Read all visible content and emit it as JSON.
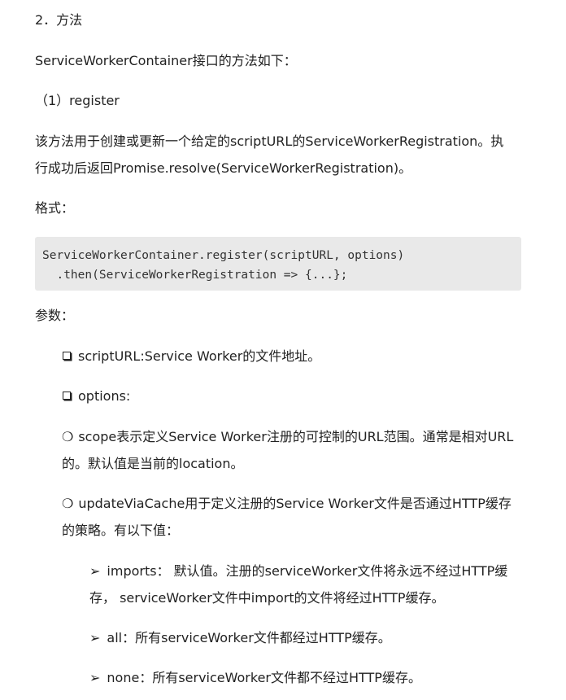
{
  "section_heading": "2．方法",
  "intro": "ServiceWorkerContainer接口的方法如下：",
  "method_heading": "（1）register",
  "description_line1": "该方法用于创建或更新一个给定的scriptURL的ServiceWorkerRegistration。执",
  "description_line2": "行成功后返回Promise.resolve(ServiceWorkerRegistration)。",
  "format_label": "格式：",
  "code_lines": [
    "ServiceWorkerContainer.register(scriptURL, options)",
    "  .then(ServiceWorkerRegistration => {...};"
  ],
  "params_label": "参数：",
  "params": {
    "scripturl": "scriptURL:Service Worker的文件地址。",
    "options": "options:",
    "scope_line1": "scope表示定义Service Worker注册的可控制的URL范围。通常是相对URL",
    "scope_line2": "的。默认值是当前的location。",
    "update_line1": "updateViaCache用于定义注册的Service Worker文件是否通过HTTP缓存",
    "update_line2": "的策略。有以下值：",
    "imports_line1": "imports：  默认值。注册的serviceWorker文件将永远不经过HTTP缓",
    "imports_line2": "存，  serviceWorker文件中import的文件将经过HTTP缓存。",
    "all": "all：所有serviceWorker文件都经过HTTP缓存。",
    "none": "none：所有serviceWorker文件都不经过HTTP缓存。"
  },
  "bullets": {
    "circle": "❍",
    "arrow": "➢"
  }
}
